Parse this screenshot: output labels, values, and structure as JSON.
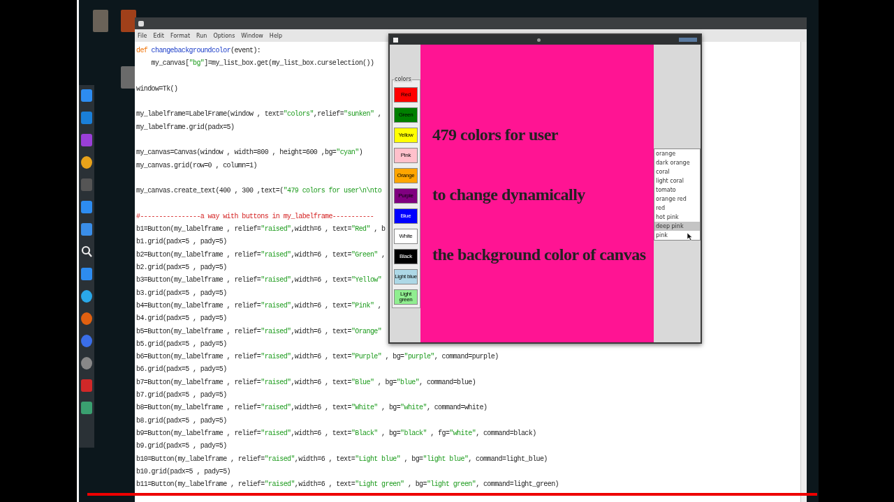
{
  "editor": {
    "menu": [
      "File",
      "Edit",
      "Format",
      "Run",
      "Options",
      "Window",
      "Help"
    ],
    "blocks": [
      [
        {
          "kind": "def",
          "text": "def changebackgroundcolor(event):"
        },
        {
          "kind": "code",
          "text": "    my_canvas[\"bg\"]=my_list_box.get(my_list_box.curselection())"
        }
      ],
      [
        {
          "kind": "code",
          "text": "window=Tk()"
        }
      ],
      [
        {
          "kind": "code",
          "text": "my_labelframe=LabelFrame(window , text=\"colors\",relief=\"sunken\" ,"
        },
        {
          "kind": "code",
          "text": "my_labelframe.grid(padx=5)"
        }
      ],
      [
        {
          "kind": "code",
          "text": "my_canvas=Canvas(window , width=800 , height=600 ,bg=\"cyan\")"
        },
        {
          "kind": "code",
          "text": "my_canvas.grid(row=0 , column=1)"
        }
      ],
      [
        {
          "kind": "code",
          "text": "my_canvas.create_text(400 , 300 ,text=(\"479 colors for user\\n\\nto"
        }
      ],
      [
        {
          "kind": "comment",
          "text": "#----------------a way with buttons in my_labelframe-----------"
        },
        {
          "kind": "code",
          "text": "b1=Button(my_labelframe , relief=\"raised\",width=6 , text=\"Red\" , b"
        },
        {
          "kind": "code",
          "text": "b1.grid(padx=5 , pady=5)"
        },
        {
          "kind": "code",
          "text": "b2=Button(my_labelframe , relief=\"raised\",width=6 , text=\"Green\" ,"
        },
        {
          "kind": "code",
          "text": "b2.grid(padx=5 , pady=5)"
        },
        {
          "kind": "code",
          "text": "b3=Button(my_labelframe , relief=\"raised\",width=6 , text=\"Yellow\""
        },
        {
          "kind": "code",
          "text": "b3.grid(padx=5 , pady=5)"
        },
        {
          "kind": "code",
          "text": "b4=Button(my_labelframe , relief=\"raised\",width=6 , text=\"Pink\" ,"
        },
        {
          "kind": "code",
          "text": "b4.grid(padx=5 , pady=5)"
        },
        {
          "kind": "code",
          "text": "b5=Button(my_labelframe , relief=\"raised\",width=6 , text=\"Orange\""
        },
        {
          "kind": "code",
          "text": "b5.grid(padx=5 , pady=5)"
        },
        {
          "kind": "code",
          "text": "b6=Button(my_labelframe , relief=\"raised\",width=6 , text=\"Purple\" , bg=\"purple\", command=purple)"
        },
        {
          "kind": "code",
          "text": "b6.grid(padx=5 , pady=5)"
        },
        {
          "kind": "code",
          "text": "b7=Button(my_labelframe , relief=\"raised\",width=6 , text=\"Blue\" , bg=\"blue\", command=blue)"
        },
        {
          "kind": "code",
          "text": "b7.grid(padx=5 , pady=5)"
        },
        {
          "kind": "code",
          "text": "b8=Button(my_labelframe , relief=\"raised\",width=6 , text=\"White\" , bg=\"white\", command=white)"
        },
        {
          "kind": "code",
          "text": "b8.grid(padx=5 , pady=5)"
        },
        {
          "kind": "code",
          "text": "b9=Button(my_labelframe , relief=\"raised\",width=6 , text=\"Black\" , bg=\"black\" , fg=\"white\", command=black)"
        },
        {
          "kind": "code",
          "text": "b9.grid(padx=5 , pady=5)"
        },
        {
          "kind": "code",
          "text": "b10=Button(my_labelframe , relief=\"raised\",width=6 , text=\"Light blue\" , bg=\"light blue\", command=light_blue)"
        },
        {
          "kind": "code",
          "text": "b10.grid(padx=5 , pady=5)"
        },
        {
          "kind": "code",
          "text": "b11=Button(my_labelframe , relief=\"raised\",width=6 , text=\"Light green\" , bg=\"light green\", command=light_green)"
        }
      ]
    ]
  },
  "tk_window": {
    "labelframe": {
      "label": "colors"
    },
    "buttons": [
      {
        "label": "Red",
        "color": "#ff0000"
      },
      {
        "label": "Green",
        "color": "#008000"
      },
      {
        "label": "Yellow",
        "color": "#ffff00"
      },
      {
        "label": "Pink",
        "color": "#ffc0cb"
      },
      {
        "label": "Orange",
        "color": "#ffa500"
      },
      {
        "label": "Purple",
        "color": "#800080"
      },
      {
        "label": "Blue",
        "color": "#0000ff"
      },
      {
        "label": "White",
        "color": "#ffffff"
      },
      {
        "label": "Black",
        "color": "#000000"
      },
      {
        "label": "Light blue",
        "color": "#add8e6"
      },
      {
        "label": "Light green",
        "color": "#90ee90"
      }
    ],
    "canvas": {
      "color": "#ff1493",
      "lines": [
        "479 colors for user",
        "to change dynamically",
        "the background color of canvas"
      ]
    },
    "listbox": [
      {
        "label": "orange",
        "selected": false
      },
      {
        "label": "dark orange",
        "selected": false
      },
      {
        "label": "coral",
        "selected": false
      },
      {
        "label": "light coral",
        "selected": false
      },
      {
        "label": "tomato",
        "selected": false
      },
      {
        "label": "orange red",
        "selected": false
      },
      {
        "label": "red",
        "selected": false
      },
      {
        "label": "hot pink",
        "selected": false
      },
      {
        "label": "deep pink",
        "selected": true
      },
      {
        "label": "pink",
        "selected": false
      }
    ]
  },
  "progress_bar": {
    "level": 1
  }
}
